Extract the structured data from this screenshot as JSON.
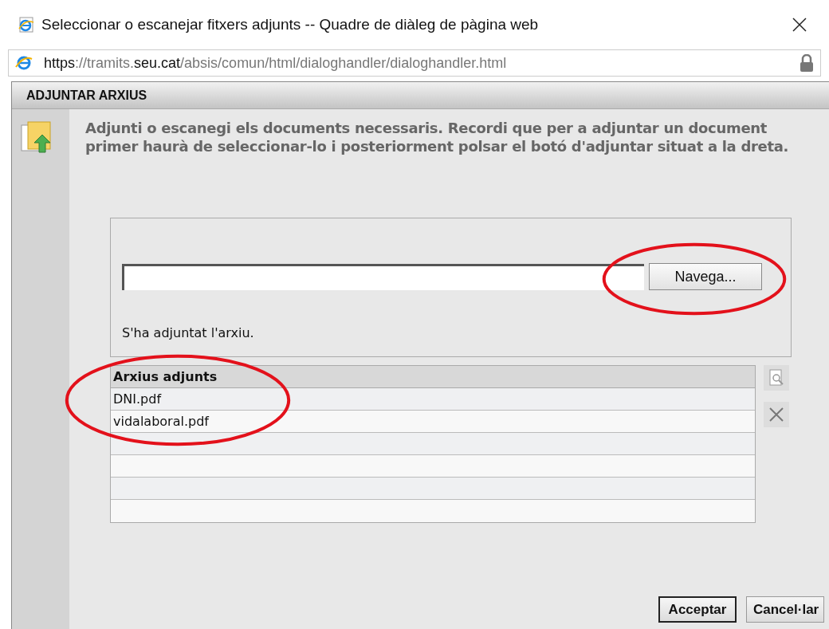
{
  "window": {
    "title": "Seleccionar o escanejar fitxers adjunts -- Quadre de diàleg de pàgina web"
  },
  "address_bar": {
    "url_parts": [
      {
        "text": "https",
        "strong": true
      },
      {
        "text": "://tramits.",
        "strong": false
      },
      {
        "text": "seu.cat",
        "strong": true
      },
      {
        "text": "/absis/comun/html/dialoghandler/dialoghandler.html",
        "strong": false
      }
    ]
  },
  "panel": {
    "title": "ADJUNTAR ARXIUS",
    "instructions": "Adjunti o escanegi els documents necessaris. Recordi que per a adjuntar un document primer haurà de seleccionar-lo i posteriorment polsar el botó d'adjuntar situat a la dreta."
  },
  "upload": {
    "browse_button": "Navega...",
    "status": "S'ha adjuntat l'arxiu."
  },
  "table": {
    "columns": [
      "Arxius adjunts"
    ],
    "rows": [
      [
        "DNI.pdf"
      ],
      [
        "vidalaboral.pdf"
      ]
    ]
  },
  "buttons": [
    {
      "label": "Acceptar",
      "default": true
    },
    {
      "label": "Cancel·lar",
      "default": false
    }
  ]
}
